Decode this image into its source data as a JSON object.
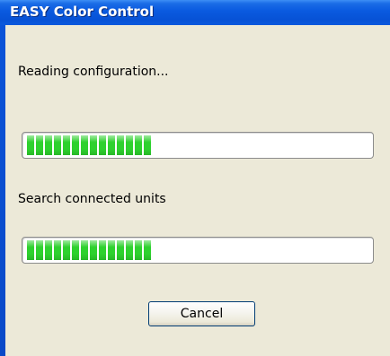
{
  "window": {
    "title": "EASY Color Control"
  },
  "dialog": {
    "step1_label": "Reading configuration...",
    "step1_progress_percent": 37,
    "step2_label": "Search connected units",
    "step2_progress_percent": 37,
    "cancel_label": "Cancel"
  },
  "colors": {
    "titlebar": "#0a5ae0",
    "client_background": "#ece9d8",
    "progress_fill": "#2ed12e"
  }
}
